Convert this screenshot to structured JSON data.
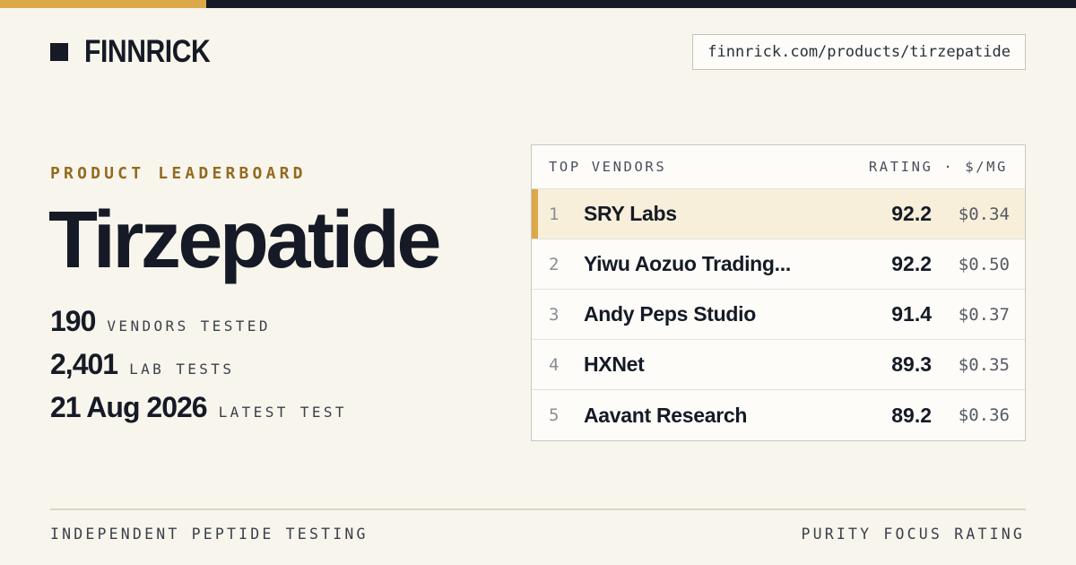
{
  "brand": {
    "name": "FINNRICK",
    "url": "finnrick.com/products/tirzepatide"
  },
  "hero": {
    "kicker": "PRODUCT LEADERBOARD",
    "title": "Tirzepatide",
    "stats": [
      {
        "value": "190",
        "label": "VENDORS TESTED"
      },
      {
        "value": "2,401",
        "label": "LAB TESTS"
      },
      {
        "value": "21 Aug 2026",
        "label": "LATEST TEST"
      }
    ]
  },
  "leaderboard": {
    "header_left": "TOP VENDORS",
    "header_right": "RATING · $/MG",
    "rows": [
      {
        "rank": "1",
        "vendor": "SRY Labs",
        "rating": "92.2",
        "price": "$0.34"
      },
      {
        "rank": "2",
        "vendor": "Yiwu Aozuo Trading...",
        "rating": "92.2",
        "price": "$0.50"
      },
      {
        "rank": "3",
        "vendor": "Andy Peps Studio",
        "rating": "91.4",
        "price": "$0.37"
      },
      {
        "rank": "4",
        "vendor": "HXNet",
        "rating": "89.3",
        "price": "$0.35"
      },
      {
        "rank": "5",
        "vendor": "Aavant Research",
        "rating": "89.2",
        "price": "$0.36"
      }
    ]
  },
  "footer": {
    "left": "INDEPENDENT PEPTIDE TESTING",
    "right": "PURITY FOCUS RATING"
  },
  "colors": {
    "accent": "#dba84a",
    "ink": "#151a26",
    "background": "#f8f5ec",
    "kicker": "#946a22"
  }
}
